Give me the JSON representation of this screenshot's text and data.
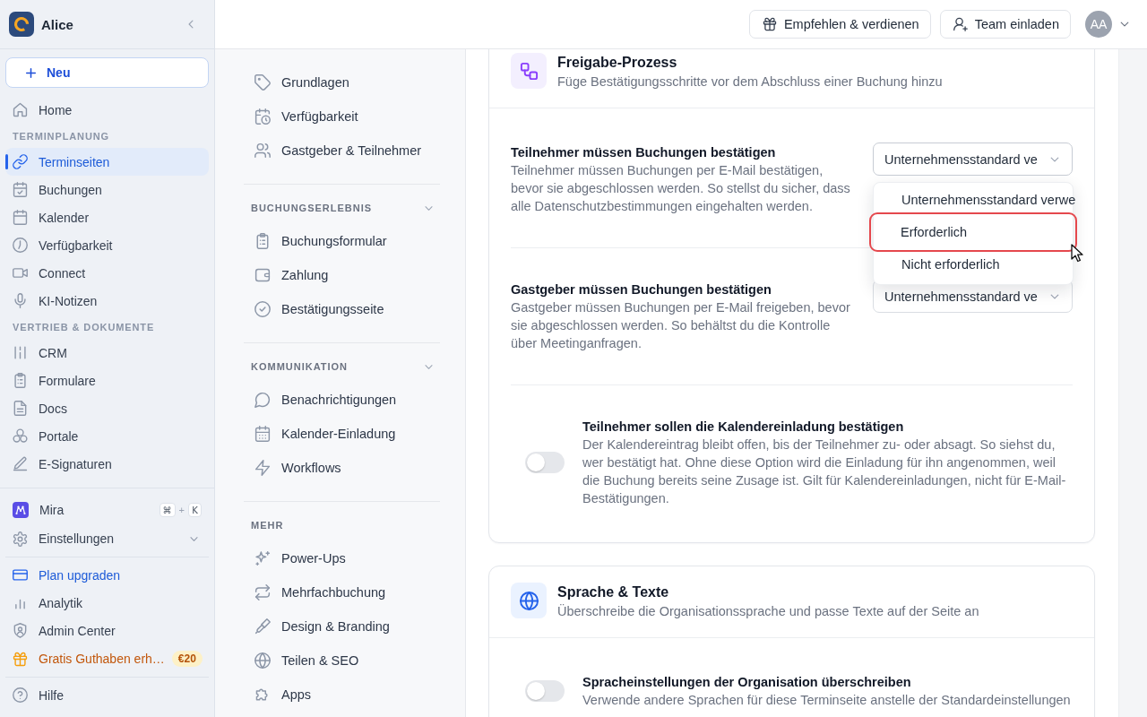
{
  "sidebar": {
    "workspace": "Alice",
    "new_button": "Neu",
    "items": [
      {
        "label": "Home",
        "selected": false
      }
    ],
    "sections": [
      {
        "title": "TERMINPLANUNG",
        "items": [
          {
            "label": "Terminseiten",
            "selected": true
          },
          {
            "label": "Buchungen",
            "selected": false
          },
          {
            "label": "Kalender",
            "selected": false
          },
          {
            "label": "Verfügbarkeit",
            "selected": false
          },
          {
            "label": "Connect",
            "selected": false
          },
          {
            "label": "KI-Notizen",
            "selected": false
          }
        ]
      },
      {
        "title": "VERTRIEB & DOKUMENTE",
        "items": [
          {
            "label": "CRM",
            "selected": false
          },
          {
            "label": "Formulare",
            "selected": false
          },
          {
            "label": "Docs",
            "selected": false
          },
          {
            "label": "Portale",
            "selected": false
          },
          {
            "label": "E-Signaturen",
            "selected": false
          }
        ]
      }
    ],
    "assistant": {
      "label": "Mira",
      "shortcut_keys": [
        "⌘",
        "K"
      ],
      "shortcut_joiner": "+"
    },
    "settings": {
      "label": "Einstellungen",
      "expanded": false
    },
    "footer_items": [
      {
        "kind": "upgrade",
        "label": "Plan upgraden"
      },
      {
        "kind": "link",
        "label": "Analytik"
      },
      {
        "kind": "link",
        "label": "Admin Center"
      },
      {
        "kind": "promo",
        "label": "Gratis Guthaben erh…",
        "badge": "€20"
      }
    ],
    "help": "Hilfe"
  },
  "topbar": {
    "buttons": [
      {
        "label": "Empfehlen & verdienen"
      },
      {
        "label": "Team einladen"
      }
    ],
    "avatar": "AA"
  },
  "page_nav": {
    "items": [
      {
        "label": "Grundlagen",
        "selected": false
      },
      {
        "label": "Verfügbarkeit",
        "selected": false
      },
      {
        "label": "Gastgeber & Teilnehmer",
        "selected": false
      }
    ],
    "sections": [
      {
        "title": "BUCHUNGSERLEBNIS",
        "kind": "collapsible",
        "expanded": true,
        "items": [
          {
            "label": "Buchungsformular",
            "selected": false
          },
          {
            "label": "Zahlung",
            "selected": false
          },
          {
            "label": "Bestätigungsseite",
            "selected": false
          }
        ]
      },
      {
        "title": "KOMMUNIKATION",
        "kind": "collapsible",
        "expanded": true,
        "items": [
          {
            "label": "Benachrichtigungen",
            "selected": false
          },
          {
            "label": "Kalender-Einladung",
            "selected": false
          },
          {
            "label": "Workflows",
            "selected": false
          }
        ]
      },
      {
        "title": "MEHR",
        "kind": "plain",
        "items": [
          {
            "label": "Power-Ups",
            "selected": false
          },
          {
            "label": "Mehrfachbuchung",
            "selected": false
          },
          {
            "label": "Design & Branding",
            "selected": false
          },
          {
            "label": "Teilen & SEO",
            "selected": false
          },
          {
            "label": "Apps",
            "selected": false
          }
        ]
      }
    ]
  },
  "cards": [
    {
      "title": "Freigabe-Prozess",
      "subtitle": "Füge Bestätigungsschritte vor dem Abschluss einer Buchung hinzu",
      "rows": [
        {
          "kind": "select",
          "title": "Teilnehmer müssen Buchungen bestätigen",
          "description": "Teilnehmer müssen Buchungen per E-Mail bestätigen, bevor sie abgeschlossen werden. So stellst du sicher, dass alle Datenschutzbestimmungen eingehalten werden.",
          "value": "Unternehmensstandard ve",
          "open": true,
          "options": [
            {
              "label": "Unternehmensstandard verwe",
              "highlighted": false
            },
            {
              "label": "Erforderlich",
              "highlighted": true
            },
            {
              "label": "Nicht erforderlich",
              "highlighted": false
            }
          ]
        },
        {
          "kind": "select",
          "title": "Gastgeber müssen Buchungen bestätigen",
          "description": "Gastgeber müssen Buchungen per E-Mail freigeben, bevor sie abgeschlossen werden. So behältst du die Kontrolle über Meetinganfragen.",
          "value": "Unternehmensstandard ve",
          "open": false
        },
        {
          "kind": "toggle",
          "title": "Teilnehmer sollen die Kalendereinladung bestätigen",
          "description": "Der Kalendereintrag bleibt offen, bis der Teilnehmer zu- oder absagt. So siehst du, wer bestätigt hat. Ohne diese Option wird die Einladung für ihn angenommen, weil die Buchung bereits seine Zusage ist. Gilt für Kalendereinladungen, nicht für E-Mail-Bestätigungen.",
          "on": false
        }
      ]
    },
    {
      "title": "Sprache & Texte",
      "subtitle": "Überschreibe die Organisationssprache und passe Texte auf der Seite an",
      "rows": [
        {
          "kind": "toggle",
          "title": "Spracheinstellungen der Organisation überschreiben",
          "description": "Verwende andere Sprachen für diese Terminseite anstelle der Standardeinstellungen",
          "on": false
        }
      ]
    }
  ]
}
